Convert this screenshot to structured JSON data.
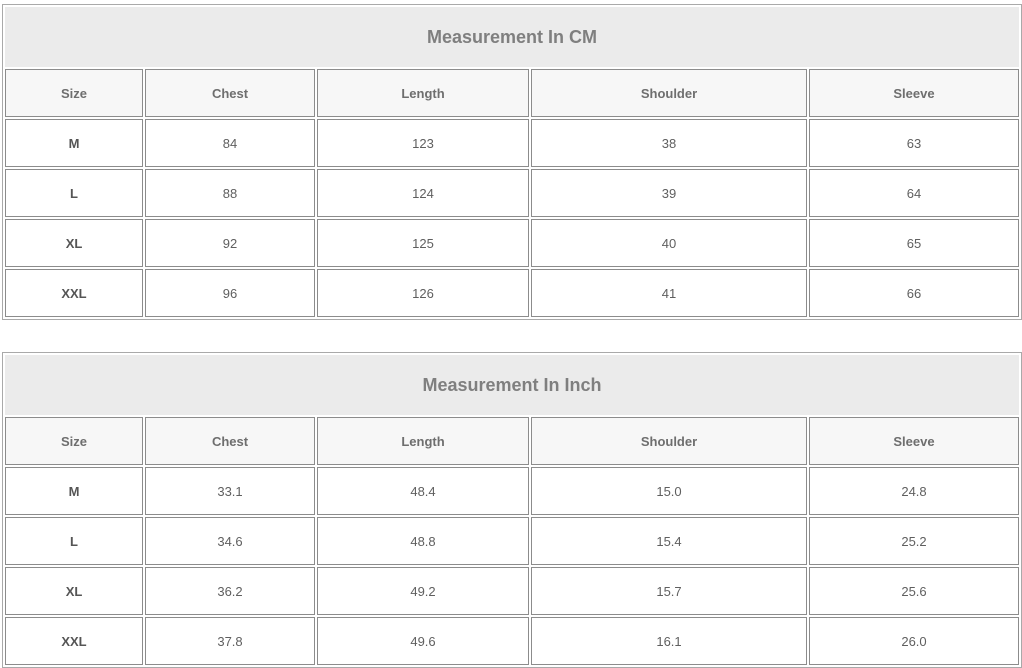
{
  "tables": [
    {
      "title": "Measurement In CM",
      "headers": [
        "Size",
        "Chest",
        "Length",
        "Shoulder",
        "Sleeve"
      ],
      "rows": [
        [
          "M",
          "84",
          "123",
          "38",
          "63"
        ],
        [
          "L",
          "88",
          "124",
          "39",
          "64"
        ],
        [
          "XL",
          "92",
          "125",
          "40",
          "65"
        ],
        [
          "XXL",
          "96",
          "126",
          "41",
          "66"
        ]
      ]
    },
    {
      "title": "Measurement In Inch",
      "headers": [
        "Size",
        "Chest",
        "Length",
        "Shoulder",
        "Sleeve"
      ],
      "rows": [
        [
          "M",
          "33.1",
          "48.4",
          "15.0",
          "24.8"
        ],
        [
          "L",
          "34.6",
          "48.8",
          "15.4",
          "25.2"
        ],
        [
          "XL",
          "36.2",
          "49.2",
          "15.7",
          "25.6"
        ],
        [
          "XXL",
          "37.8",
          "49.6",
          "16.1",
          "26.0"
        ]
      ]
    }
  ],
  "colors": {
    "title_background": "#ebebeb",
    "header_background": "#f7f7f7",
    "border": "#8c8c8c",
    "text": "#555555"
  }
}
